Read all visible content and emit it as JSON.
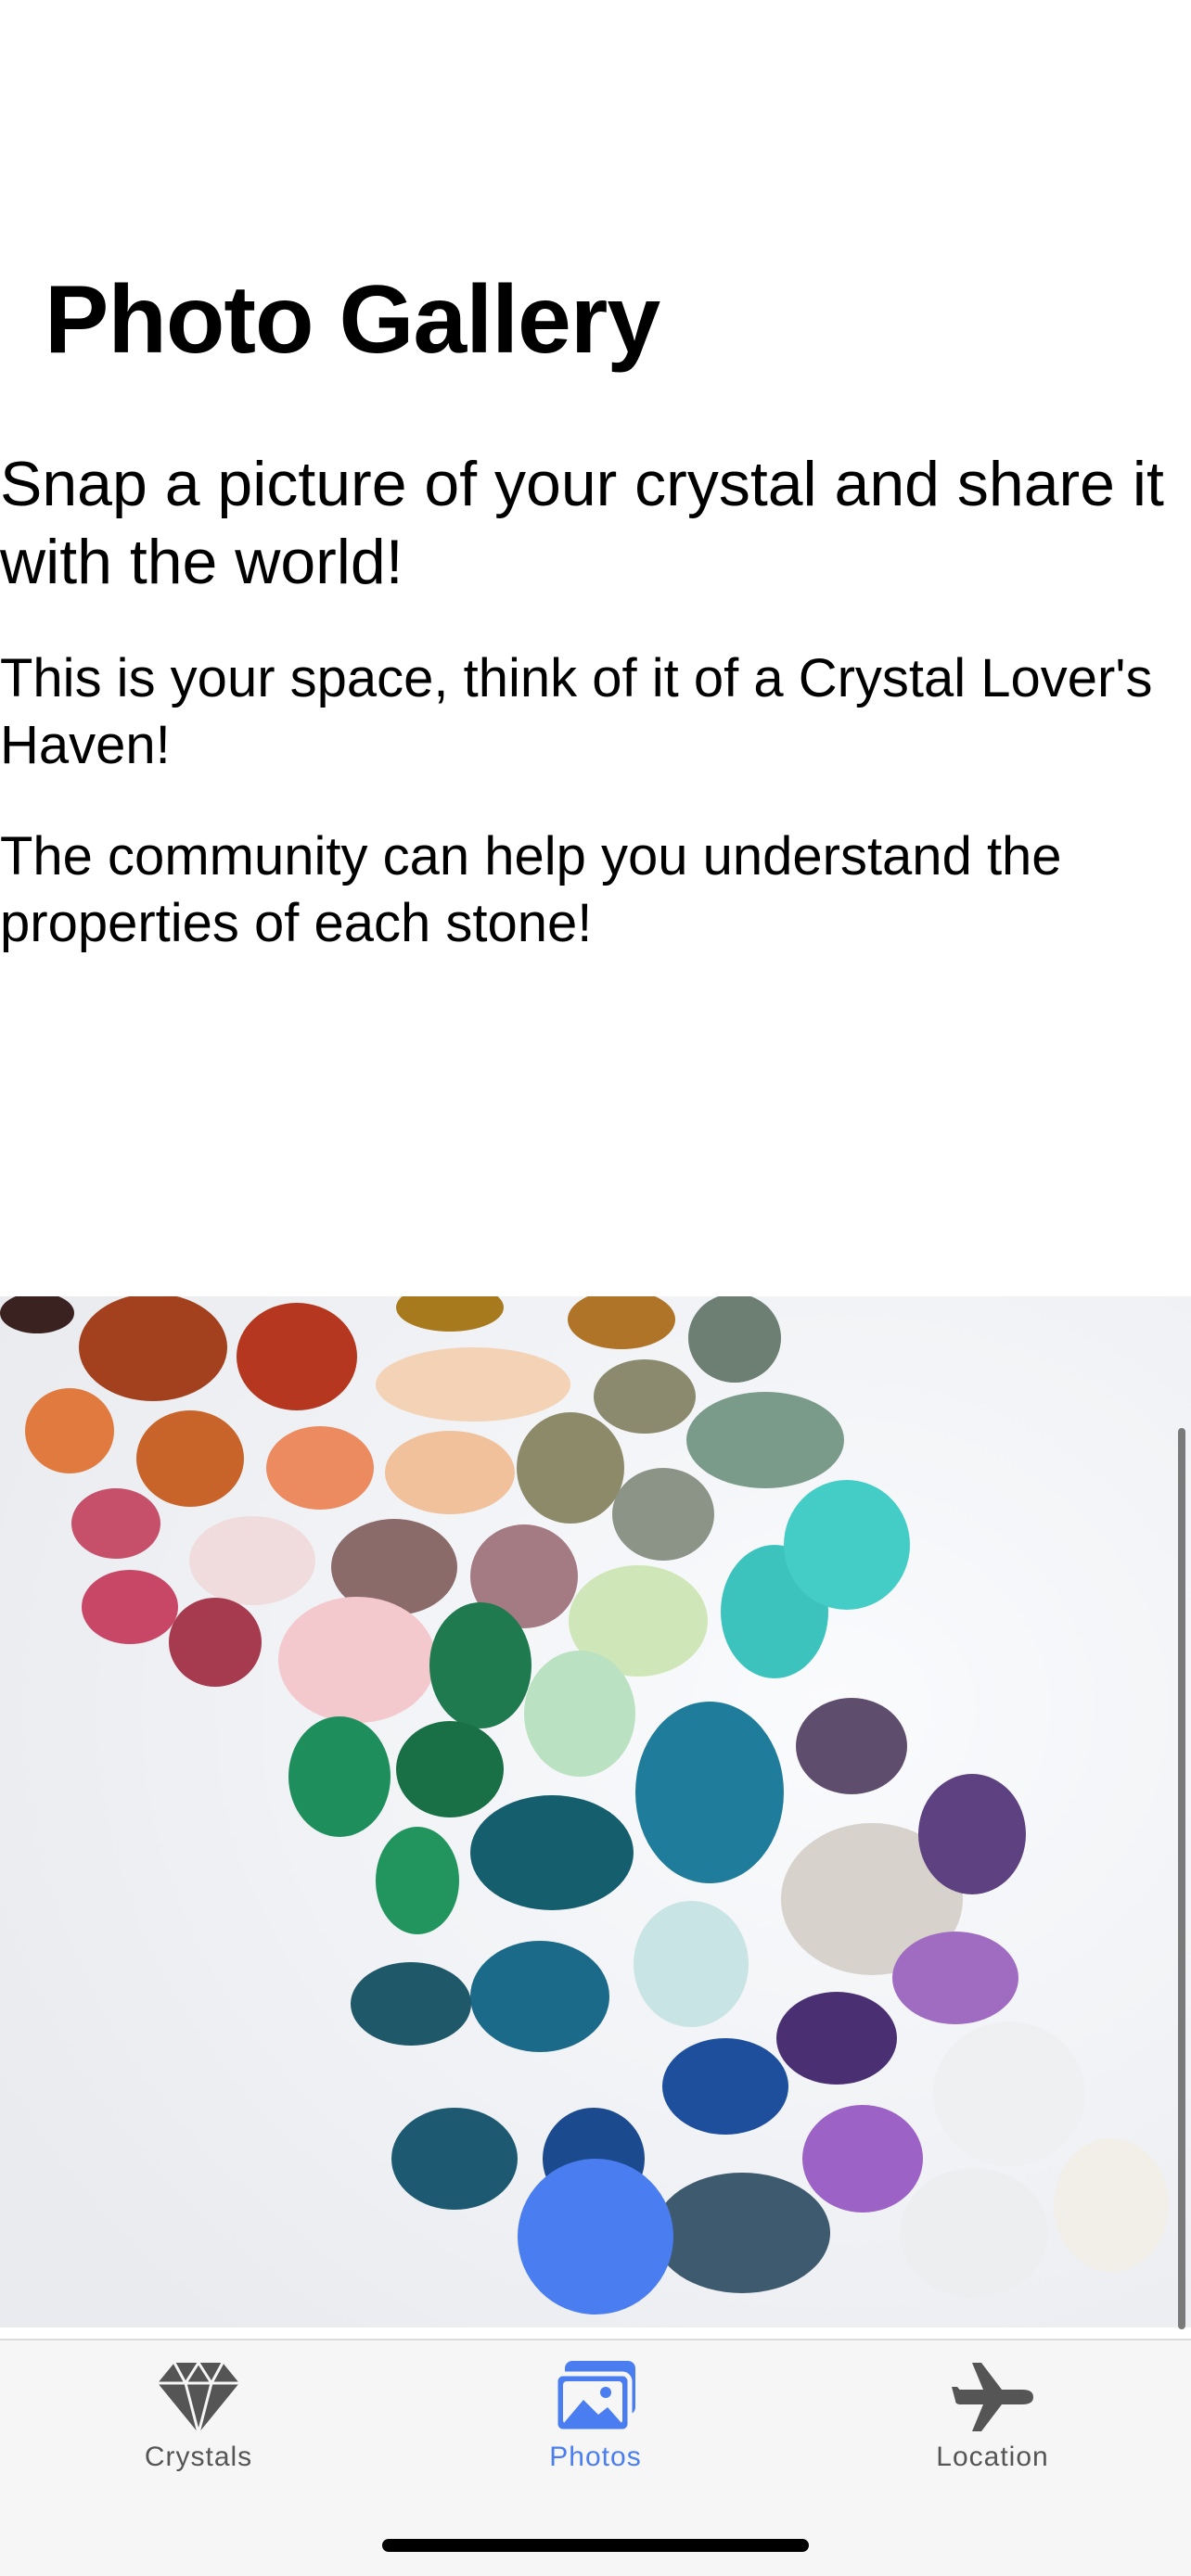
{
  "page": {
    "title": "Photo Gallery",
    "headline": "Snap a picture of your crystal and share it with the world!",
    "paragraphs": [
      "This is your space, think of it of a Crystal Lover's Haven!",
      "The community can help you understand the properties of each stone!"
    ]
  },
  "gallery": {
    "image_alt": "Assorted tumbled crystals and gemstones arranged in a rainbow pattern",
    "icon": "crystal-collection-photo"
  },
  "fab": {
    "icon": "add-photo-button",
    "color": "#4a7ef0"
  },
  "tabbar": {
    "active_color": "#4a7ef0",
    "inactive_color": "#555555",
    "tabs": [
      {
        "label": "Crystals",
        "icon": "diamond-icon",
        "active": false
      },
      {
        "label": "Photos",
        "icon": "photos-icon",
        "active": true
      },
      {
        "label": "Location",
        "icon": "airplane-icon",
        "active": false
      }
    ]
  }
}
